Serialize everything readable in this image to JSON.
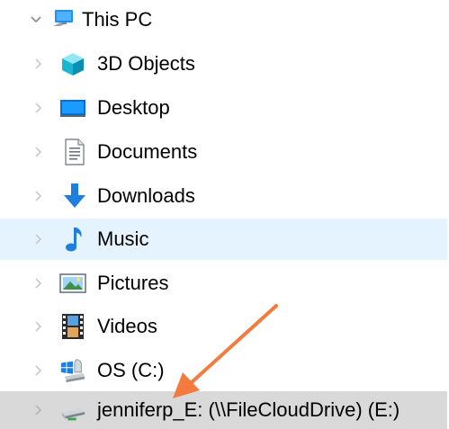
{
  "tree": {
    "root": {
      "label": "This PC",
      "expanded": true
    },
    "children": [
      {
        "label": "3D Objects",
        "icon": "3d-objects-icon"
      },
      {
        "label": "Desktop",
        "icon": "desktop-icon"
      },
      {
        "label": "Documents",
        "icon": "documents-icon"
      },
      {
        "label": "Downloads",
        "icon": "downloads-icon"
      },
      {
        "label": "Music",
        "icon": "music-icon",
        "state": "hover"
      },
      {
        "label": "Pictures",
        "icon": "pictures-icon"
      },
      {
        "label": "Videos",
        "icon": "videos-icon"
      },
      {
        "label": "OS (C:)",
        "icon": "os-drive-icon"
      },
      {
        "label": "jenniferp_E: (\\\\FileCloudDrive) (E:)",
        "icon": "network-drive-icon",
        "state": "selected"
      }
    ]
  },
  "annotation": {
    "type": "arrow",
    "color": "#f47b3e",
    "points_to": "network-drive"
  }
}
